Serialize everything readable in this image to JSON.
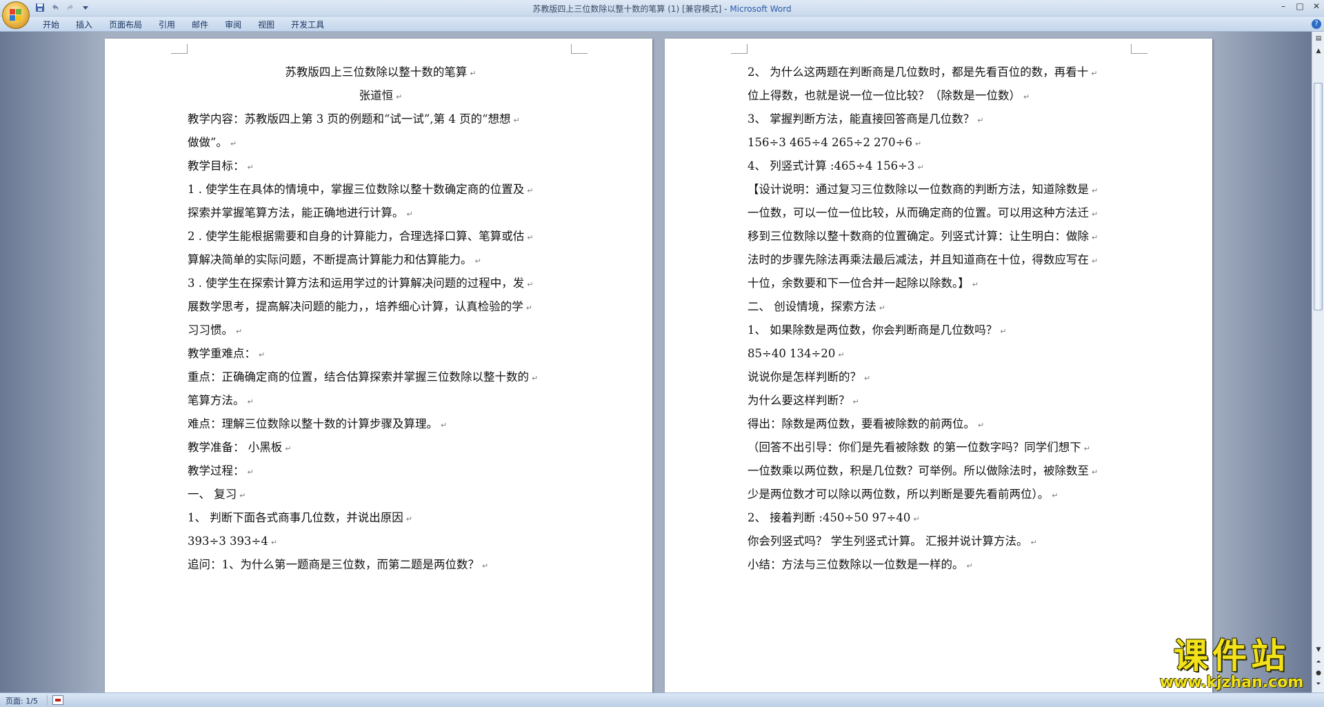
{
  "window": {
    "title": "苏教版四上三位数除以整十数的笔算 (1) [兼容模式] - ",
    "app_name": "Microsoft Word",
    "controls": [
      "–",
      "□",
      "✕"
    ]
  },
  "quick_access": {
    "icons": [
      "save-icon",
      "undo-icon",
      "redo-icon",
      "customize-icon"
    ]
  },
  "ribbon": {
    "tabs": [
      "开始",
      "插入",
      "页面布局",
      "引用",
      "邮件",
      "审阅",
      "视图",
      "开发工具"
    ]
  },
  "pages": {
    "left": [
      {
        "text": "苏教版四上三位数除以整十数的笔算",
        "center": true
      },
      {
        "text": "张道恒",
        "center": true
      },
      {
        "text": "教学内容：苏教版四上第 3 页的例题和“试一试”,第 4 页的“想想"
      },
      {
        "text": "做做”。"
      },
      {
        "text": "教学目标："
      },
      {
        "text": "1 . 使学生在具体的情境中，掌握三位数除以整十数确定商的位置及"
      },
      {
        "text": "探索并掌握笔算方法，能正确地进行计算。"
      },
      {
        "text": "2 . 使学生能根据需要和自身的计算能力，合理选择口算、笔算或估"
      },
      {
        "text": "算解决简单的实际问题，不断提高计算能力和估算能力。"
      },
      {
        "text": "3 . 使学生在探索计算方法和运用学过的计算解决问题的过程中，发"
      },
      {
        "text": "展数学思考，提高解决问题的能力，，培养细心计算，认真检验的学"
      },
      {
        "text": "习习惯。"
      },
      {
        "text": "教学重难点："
      },
      {
        "text": "重点：正确确定商的位置，结合估算探索并掌握三位数除以整十数的"
      },
      {
        "text": "笔算方法。"
      },
      {
        "text": "难点：理解三位数除以整十数的计算步骤及算理。"
      },
      {
        "text": "教学准备：  小黑板"
      },
      {
        "text": "教学过程："
      },
      {
        "text": "一、  复习"
      },
      {
        "text": "1、  判断下面各式商事几位数，并说出原因"
      },
      {
        "text": "393÷3 393÷4"
      },
      {
        "text": "追问：1、为什么第一题商是三位数，而第二题是两位数？"
      }
    ],
    "right": [
      {
        "text": "2、  为什么这两题在判断商是几位数时，都是先看百位的数，再看十"
      },
      {
        "text": "位上得数，也就是说一位一位比较？（除数是一位数）"
      },
      {
        "text": "3、  掌握判断方法，能直接回答商是几位数？"
      },
      {
        "text": "156÷3        465÷4         265÷2            270÷6"
      },
      {
        "text": "4、  列竖式计算 :465÷4 156÷3"
      },
      {
        "text": "【设计说明：通过复习三位数除以一位数商的判断方法，知道除数是"
      },
      {
        "text": "一位数，可以一位一位比较，从而确定商的位置。可以用这种方法迁"
      },
      {
        "text": "移到三位数除以整十数商的位置确定。列竖式计算：让生明白：做除"
      },
      {
        "text": "法时的步骤先除法再乘法最后减法，并且知道商在十位，得数应写在"
      },
      {
        "text": "十位，余数要和下一位合并一起除以除数。】"
      },
      {
        "text": "二、  创设情境，探索方法"
      },
      {
        "text": "1、  如果除数是两位数，你会判断商是几位数吗？"
      },
      {
        "text": "85÷40 134÷20"
      },
      {
        "text": "说说你是怎样判断的？"
      },
      {
        "text": "为什么要这样判断？"
      },
      {
        "text": "得出：除数是两位数，要看被除数的前两位。"
      },
      {
        "text": "（回答不出引导：你们是先看被除数  的第一位数字吗？同学们想下"
      },
      {
        "text": "一位数乘以两位数，积是几位数？可举例。所以做除法时，被除数至"
      },
      {
        "text": "少是两位数才可以除以两位数，所以判断是要先看前两位）。"
      },
      {
        "text": "2、  接着判断 :450÷50 97÷40"
      },
      {
        "text": "你会列竖式吗？  学生列竖式计算。  汇报并说计算方法。"
      },
      {
        "text": "小结：方法与三位数除以一位数是一样的。"
      }
    ]
  },
  "paragraph_mark": "↵",
  "status": {
    "page_info": "页面: 1/5"
  },
  "watermark": {
    "main": "课件站",
    "url": "www.kjzhan.com"
  }
}
